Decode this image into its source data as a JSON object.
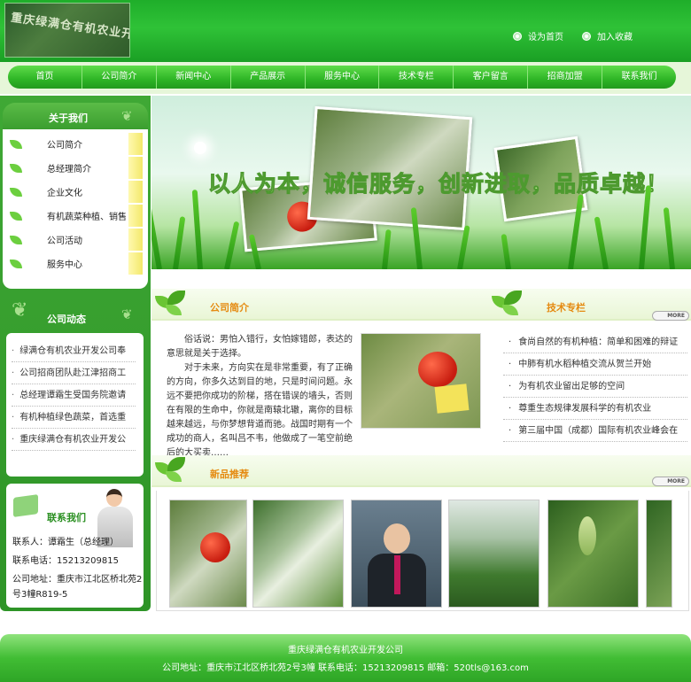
{
  "header": {
    "logo_text": "重庆绿满仓有机农业开发公司",
    "links": [
      "设为首页",
      "加入收藏"
    ]
  },
  "nav": [
    "首页",
    "公司简介",
    "新闻中心",
    "产品展示",
    "服务中心",
    "技术专栏",
    "客户留言",
    "招商加盟",
    "联系我们"
  ],
  "sidebar": {
    "about_title": "关于我们",
    "about_items": [
      "公司简介",
      "总经理简介",
      "企业文化",
      "有机蔬菜种植、销售",
      "公司活动",
      "服务中心"
    ],
    "news_title": "公司动态",
    "news_items": [
      "绿满仓有机农业开发公司奉",
      "公司招商团队赴江津招商工",
      "总经理谭霜生受国务院邀请",
      "有机种植绿色蔬菜，首选重",
      "重庆绿满仓有机农业开发公"
    ],
    "contact_title": "联系我们",
    "contact_lines": [
      "联系人：谭霜生（总经理）",
      "联系电话：15213209815",
      "公司地址：重庆市江北区桥北苑2",
      "号3幢R819-5"
    ]
  },
  "banner": {
    "slogan": "以人为本，诚信服务，创新进取，品质卓越！"
  },
  "intro": {
    "title": "公司简介",
    "more": "MORE",
    "paragraphs": [
      "俗话说：男怕入错行，女怕嫁错郎，表达的意思就是关于选择。",
      "对于未来，方向实在是非常重要，有了正确的方向，你多久达到目的地，只是时间问题。永远不要把你成功的阶梯，搭在错误的墙头，否则在有限的生命中，你就是南辕北辙，离你的目标越来越远，与你梦想背道而驰。战国时期有一个成功的商人，名叫吕不韦，他做成了一笔空前绝后的大买卖……"
    ]
  },
  "tech": {
    "title": "技术专栏",
    "more": "MORE",
    "items": [
      "食尚自然的有机种植：简单和困难的辩证",
      "中肺有机水稻种植交流从贺兰开始",
      "为有机农业留出足够的空间",
      "尊重生态规律发展科学的有机农业",
      "第三届中国（成都）国际有机农业峰会在"
    ]
  },
  "products": {
    "title": "新品推荐",
    "more": "MORE"
  },
  "footer": {
    "line1": "重庆绿满仓有机农业开发公司",
    "line2": "公司地址：重庆市江北区桥北苑2号3幢    联系电话：15213209815   邮箱：520tls@163.com"
  },
  "colors": {
    "primary_green": "#2eb526",
    "accent_orange": "#e58a10"
  }
}
